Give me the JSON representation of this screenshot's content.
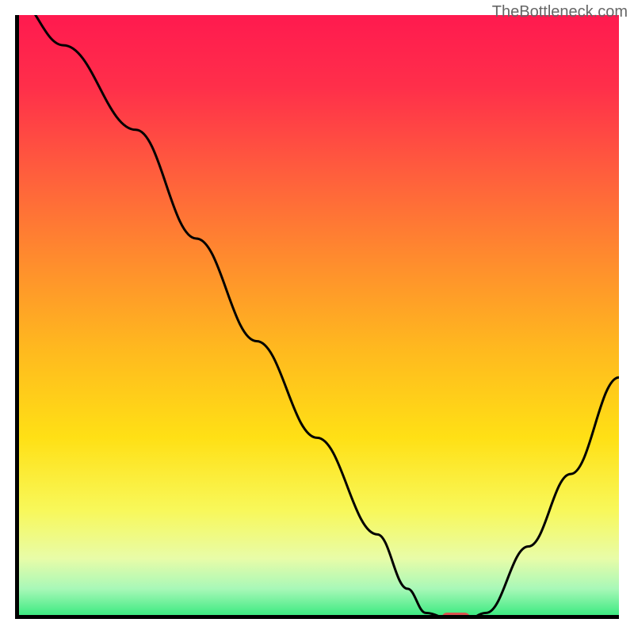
{
  "watermark": "TheBottleneck.com",
  "chart_data": {
    "type": "line",
    "title": "",
    "xlabel": "",
    "ylabel": "",
    "xlim": [
      0,
      100
    ],
    "ylim": [
      0,
      100
    ],
    "series": [
      {
        "name": "bottleneck-curve",
        "x": [
          0,
          8,
          20,
          30,
          40,
          50,
          60,
          65,
          68,
          72,
          75,
          78,
          85,
          92,
          100
        ],
        "y": [
          103,
          95,
          81,
          63,
          46,
          30,
          14,
          5,
          1,
          0,
          0,
          1,
          12,
          24,
          40
        ]
      }
    ],
    "marker": {
      "x": 73,
      "y": 0,
      "color": "#d9534f"
    },
    "gradient_stops": [
      {
        "offset": 0,
        "color": "#ff1a4f"
      },
      {
        "offset": 0.12,
        "color": "#ff2f4a"
      },
      {
        "offset": 0.25,
        "color": "#ff5a3e"
      },
      {
        "offset": 0.4,
        "color": "#ff8a2e"
      },
      {
        "offset": 0.55,
        "color": "#ffb81f"
      },
      {
        "offset": 0.7,
        "color": "#ffe015"
      },
      {
        "offset": 0.82,
        "color": "#f8f85a"
      },
      {
        "offset": 0.9,
        "color": "#e8fca8"
      },
      {
        "offset": 0.95,
        "color": "#a8f8b8"
      },
      {
        "offset": 1.0,
        "color": "#2ee87a"
      }
    ]
  }
}
